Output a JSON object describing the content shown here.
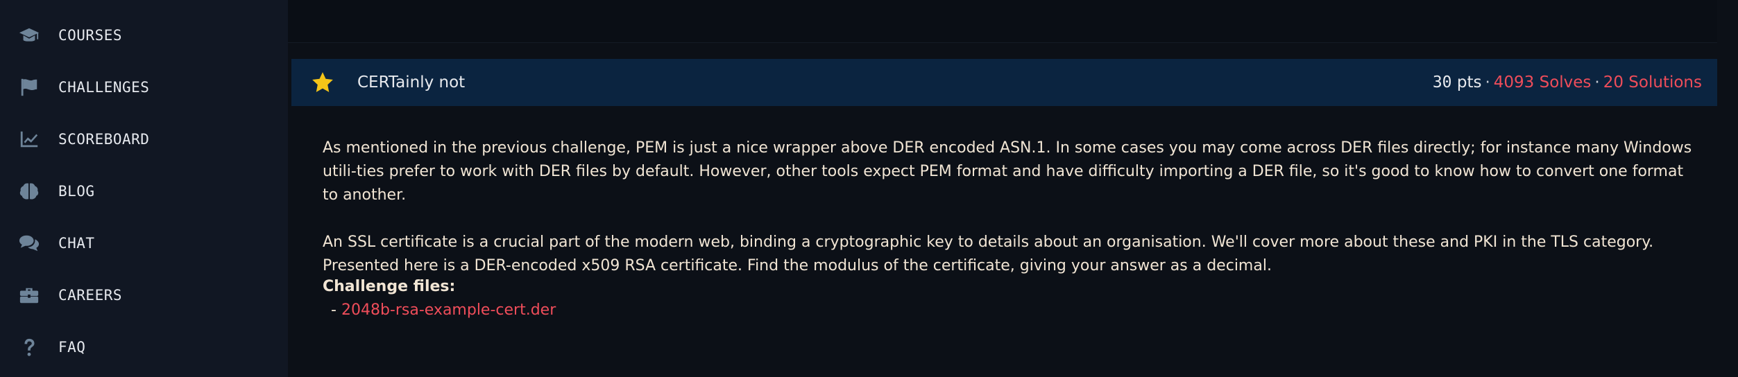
{
  "sidebar": {
    "items": [
      {
        "label": "COURSES",
        "icon": "graduation-cap-icon"
      },
      {
        "label": "CHALLENGES",
        "icon": "flag-icon"
      },
      {
        "label": "SCOREBOARD",
        "icon": "chart-line-icon"
      },
      {
        "label": "BLOG",
        "icon": "brain-icon"
      },
      {
        "label": "CHAT",
        "icon": "chat-bubbles-icon"
      },
      {
        "label": "CAREERS",
        "icon": "briefcase-icon"
      },
      {
        "label": "FAQ",
        "icon": "question-icon"
      }
    ]
  },
  "challenge": {
    "title": "CERTainly not",
    "points": "30",
    "points_unit": "pts",
    "separator": "·",
    "solves": "4093 Solves",
    "solutions": "20 Solutions",
    "description": [
      "As mentioned in the previous challenge, PEM is just a nice wrapper above DER encoded ASN.1. In some cases you may come across DER files directly; for instance many Windows utili-ties prefer to work with DER files by default. However, other tools expect PEM format and have difficulty importing a DER file, so it's good to know how to convert one format to another.",
      "An SSL certificate is a crucial part of the modern web, binding a cryptographic key to details about an organisation. We'll cover more about these and PKI in the TLS category. Presented here is a DER-encoded x509 RSA certificate. Find the modulus of the certificate, giving your answer as a decimal."
    ],
    "files_heading": "Challenge files:",
    "file_prefix": "-",
    "file_name": "2048b-rsa-example-cert.der"
  },
  "colors": {
    "accent_red": "#ef4d5a",
    "star": "#f5c518",
    "bar_bg": "#0b2440",
    "sidebar_bg": "#111723",
    "page_bg": "#0c1017"
  }
}
